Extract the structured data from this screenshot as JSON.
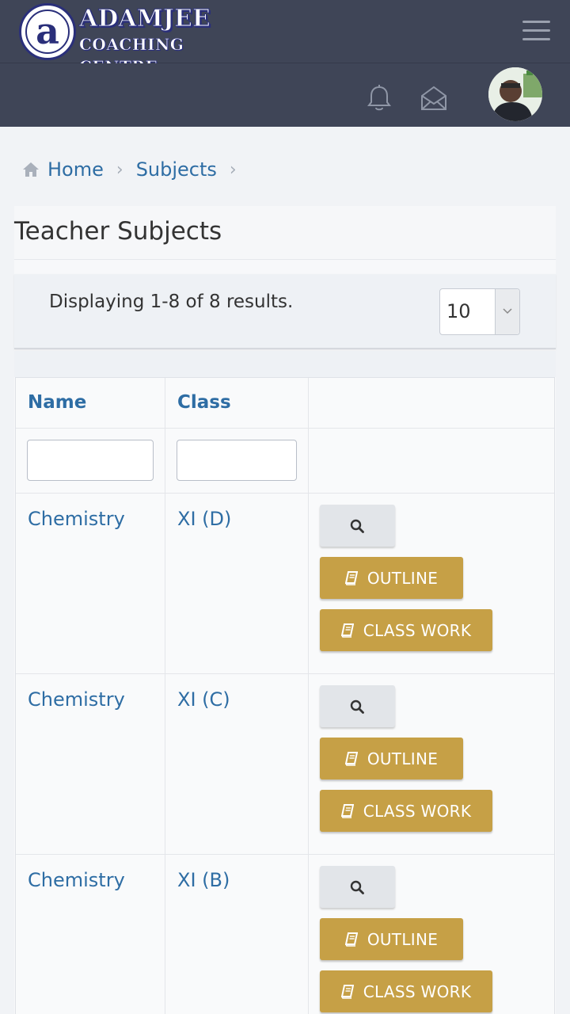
{
  "brand": {
    "letter": "a",
    "title": "ADAMJEE",
    "subtitle": "COACHING CENTRE"
  },
  "breadcrumb": {
    "home": "Home",
    "subjects": "Subjects",
    "separator": "›"
  },
  "page": {
    "title": "Teacher Subjects",
    "summary": "Displaying 1-8 of 8 results.",
    "page_size": "10"
  },
  "table": {
    "headers": {
      "name": "Name",
      "class": "Class"
    },
    "rows": [
      {
        "name": "Chemistry",
        "class": "XI (D)",
        "outline": "OUTLINE",
        "classwork": "CLASS WORK"
      },
      {
        "name": "Chemistry",
        "class": "XI (C)",
        "outline": "OUTLINE",
        "classwork": "CLASS WORK"
      },
      {
        "name": "Chemistry",
        "class": "XI (B)",
        "outline": "OUTLINE",
        "classwork": "CLASS WORK"
      }
    ]
  },
  "colors": {
    "topbar": "#3f4557",
    "link": "#2e6da4",
    "gold_button": "#c6a046"
  }
}
